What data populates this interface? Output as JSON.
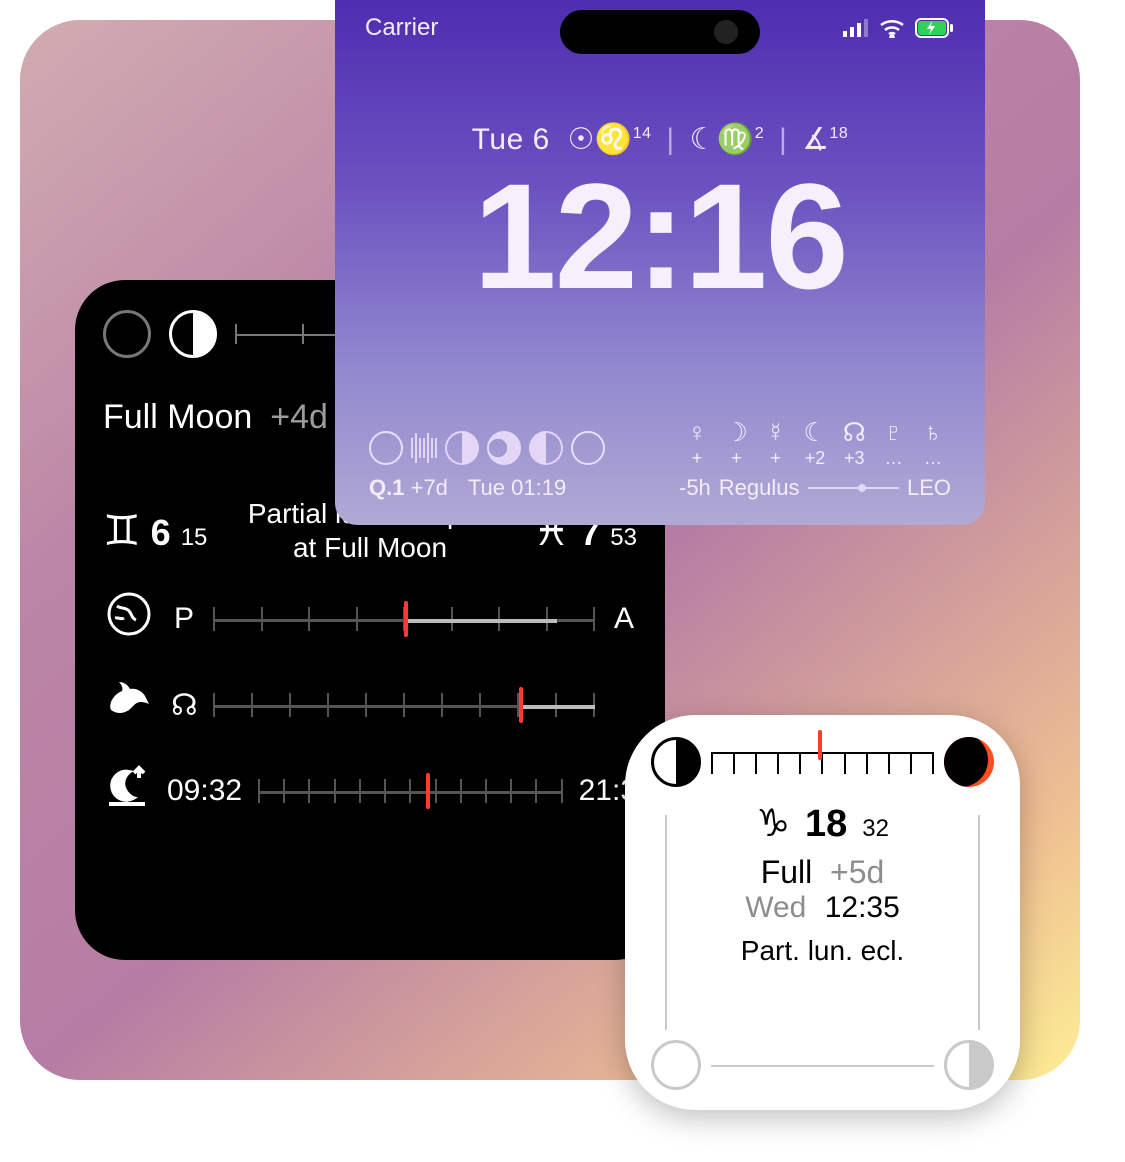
{
  "lockscreen": {
    "carrier": "Carrier",
    "date_prefix": "Tue 6",
    "sun_sign_deg": "14",
    "moon_sign_deg": "2",
    "asc_deg": "18",
    "time": "12:16",
    "phase_label": "Q.1",
    "phase_offset": "+7d",
    "phase_datetime": "Tue 01:19",
    "regulus_offset": "-5h",
    "regulus_name": "Regulus",
    "regulus_sign": "LEO",
    "planets": [
      {
        "sym": "♀",
        "val": "+"
      },
      {
        "sym": "☽",
        "val": "+"
      },
      {
        "sym": "☿",
        "val": "+"
      },
      {
        "sym": "☾",
        "val": "+2"
      },
      {
        "sym": "☊",
        "val": "+3"
      },
      {
        "sym": "♇",
        "val": "…"
      },
      {
        "sym": "♄",
        "val": "…"
      }
    ]
  },
  "dark": {
    "phase_name": "Full Moon",
    "phase_offset": "+4d",
    "event_line1": "Partial lunar eclipse",
    "event_line2": "at Full Moon",
    "left_sign_deg": "6",
    "left_sign_min": "15",
    "right_sign_deg": "7",
    "right_sign_min": "53",
    "row_pa_left": "P",
    "row_pa_right": "A",
    "time_rise": "09:32",
    "time_set": "21:3"
  },
  "white": {
    "sign_deg": "18",
    "sign_min": "32",
    "phase_name": "Full",
    "phase_offset": "+5d",
    "dow": "Wed",
    "time": "12:35",
    "event": "Part. lun. ecl."
  }
}
